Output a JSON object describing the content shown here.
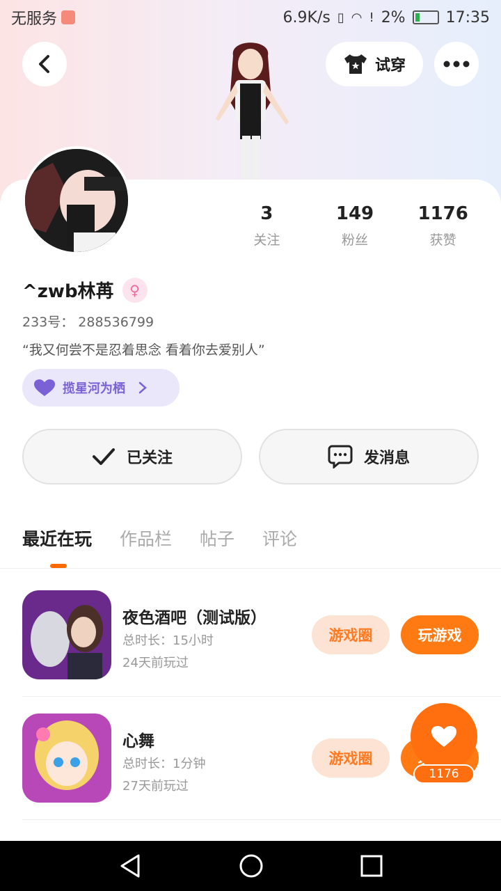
{
  "status_bar": {
    "carrier": "无服务",
    "speed": "6.9K/s",
    "battery": "2%",
    "time": "17:35"
  },
  "header": {
    "try_on_label": "试穿"
  },
  "profile": {
    "stats": [
      {
        "value": "3",
        "label": "关注"
      },
      {
        "value": "149",
        "label": "粉丝"
      },
      {
        "value": "1176",
        "label": "获赞"
      }
    ],
    "username": "^zwb林苒",
    "uid": "233号： 288536799",
    "bio": "“我又何尝不是忍着思念 看着你去爱别人”",
    "club": "揽星河为栖"
  },
  "actions": {
    "follow_label": "已关注",
    "message_label": "发消息"
  },
  "tabs": [
    "最近在玩",
    "作品栏",
    "帖子",
    "评论"
  ],
  "games": [
    {
      "name": "夜色酒吧（测试版）",
      "duration": "总时长：15小时",
      "last_played": "24天前玩过",
      "circle_label": "游戏圈",
      "play_label": "玩游戏"
    },
    {
      "name": "心舞",
      "duration": "总时长：1分钟",
      "last_played": "27天前玩过",
      "circle_label": "游戏圈",
      "play_label": "玩游戏"
    }
  ],
  "float_like": {
    "count": "1176"
  },
  "colors": {
    "accent": "#ff7a12",
    "club": "#7a62d6",
    "gender": "#f06a9a"
  }
}
